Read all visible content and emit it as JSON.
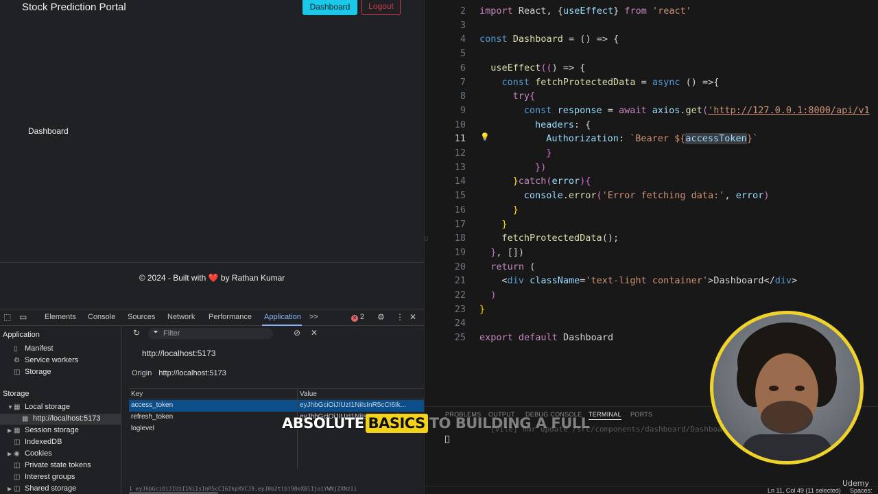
{
  "browser": {
    "brand": "Stock Prediction Portal",
    "nav": {
      "dashboard": "Dashboard",
      "logout": "Logout"
    },
    "main_text": "Dashboard",
    "footer": {
      "prefix": "© 2024 - Built with",
      "heart": "❤️",
      "suffix": "by Rathan Kumar"
    }
  },
  "devtools": {
    "tabs": [
      "Elements",
      "Console",
      "Sources",
      "Network",
      "Performance",
      "Application",
      ">>"
    ],
    "active_tab": "Application",
    "error_count": "2",
    "sidebar": {
      "application_header": "Application",
      "application_items": [
        "Manifest",
        "Service workers",
        "Storage"
      ],
      "storage_header": "Storage",
      "storage_items": [
        "Local storage",
        "http://localhost:5173",
        "Session storage",
        "IndexedDB",
        "Cookies",
        "Private state tokens",
        "Interest groups",
        "Shared storage"
      ]
    },
    "filter_placeholder": "Filter",
    "origin_title": "http://localhost:5173",
    "origin_label": "Origin",
    "origin_value": "http://localhost:5173",
    "table": {
      "headers": {
        "key": "Key",
        "value": "Value"
      },
      "rows": [
        {
          "key": "access_token",
          "value": "eyJhbGciOiJIUzI1NiIsInR5cCI6Ik..."
        },
        {
          "key": "refresh_token",
          "value": "eyJhbGciOiJIUzI1NiIsInR5cCI6Ik..."
        },
        {
          "key": "loglevel",
          "value": ""
        }
      ]
    },
    "preview": "1  eyJhbGciOiJIUzI1NiIsInR5cCI6IkpXVCJ9.eyJ0b2tlbl90eXBlIjoiYWNjZXNzIi"
  },
  "editor": {
    "current_line": 11,
    "lines": [
      {
        "n": 2
      },
      {
        "n": 3
      },
      {
        "n": 4
      },
      {
        "n": 5
      },
      {
        "n": 6
      },
      {
        "n": 7
      },
      {
        "n": 8
      },
      {
        "n": 9
      },
      {
        "n": 10
      },
      {
        "n": 11
      },
      {
        "n": 12
      },
      {
        "n": 13
      },
      {
        "n": 14
      },
      {
        "n": 15
      },
      {
        "n": 16
      },
      {
        "n": 17
      },
      {
        "n": 18
      },
      {
        "n": 19
      },
      {
        "n": 20
      },
      {
        "n": 21
      },
      {
        "n": 22
      },
      {
        "n": 23
      },
      {
        "n": 24
      },
      {
        "n": 25
      }
    ],
    "code": {
      "l2": [
        "import",
        "React, {",
        "useEffect",
        "} ",
        "from",
        " 'react'"
      ],
      "l4": [
        "const",
        " Dashboard",
        " = () => {"
      ],
      "l6": [
        "useEffect",
        "((",
        ") => {"
      ],
      "l7": [
        "const",
        " fetchProtectedData",
        " = ",
        "async",
        " () =>{"
      ],
      "l8": [
        "try",
        "{"
      ],
      "l9": [
        "const",
        " response",
        " = ",
        "await",
        " axios",
        ".",
        "get",
        "(",
        "'http://127.0.0.1:8000/api/v1"
      ],
      "l10": [
        "headers",
        ": {"
      ],
      "l11": [
        "Authorization",
        ": ",
        "`Bearer ${",
        "accessToken",
        "}`"
      ],
      "l12": [
        "}"
      ],
      "l13": [
        "})"
      ],
      "l14": [
        "}",
        "catch",
        "(",
        "error",
        "){"
      ],
      "l15": [
        "console",
        ".",
        "error",
        "(",
        "'Error fetching data:'",
        ", ",
        "error",
        ")"
      ],
      "l16": [
        "}"
      ],
      "l17": [
        "}"
      ],
      "l18": [
        "fetchProtectedData",
        "();"
      ],
      "l19": [
        "}",
        ", [])"
      ],
      "l20": [
        "return",
        " ("
      ],
      "l21": [
        "<",
        "div",
        " ",
        "className",
        "=",
        "'text-light container'",
        ">",
        "Dashboard",
        "</",
        "div",
        ">"
      ],
      "l22": [
        ")"
      ],
      "l23": [
        "}"
      ],
      "l25": [
        "export",
        " ",
        "default",
        " Dashboard"
      ]
    },
    "panel_tabs": [
      "PROBLEMS",
      "OUTPUT",
      "DEBUG CONSOLE",
      "TERMINAL",
      "PORTS"
    ],
    "active_panel": "TERMINAL",
    "terminal_text": "[vite] hmr update /src/components/dashboard/Dashboard.jsx",
    "status": {
      "position": "Ln 11, Col 49 (11 selected)",
      "spaces": "Spaces:"
    }
  },
  "caption": {
    "part1": "ABSOLUTE",
    "part2": "BASICS",
    "part3": "TO BUILDING A FULL"
  },
  "watermark": "Udemy"
}
